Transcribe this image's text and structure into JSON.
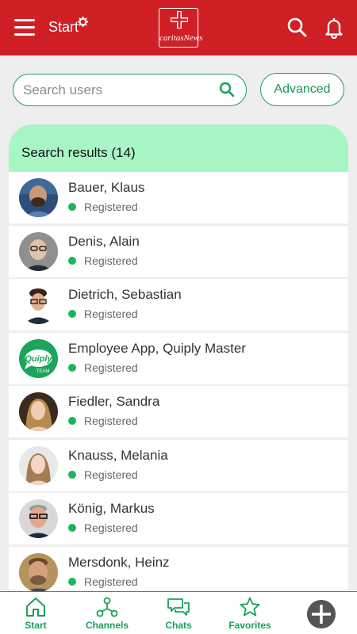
{
  "colors": {
    "brand_red": "#d11f26",
    "accent_green": "#1aa05a",
    "header_green": "#a8f5c6",
    "status_green": "#1bb55c"
  },
  "topbar": {
    "title": "Start",
    "logo_text": "caritasNews",
    "icons": [
      "menu-icon",
      "gear-icon",
      "caritas-logo",
      "search-icon",
      "bell-icon"
    ]
  },
  "search": {
    "placeholder": "Search users",
    "value": "",
    "advanced_label": "Advanced"
  },
  "results": {
    "header": "Search results (14)",
    "items": [
      {
        "name": "Bauer, Klaus",
        "status": "Registered"
      },
      {
        "name": "Denis, Alain",
        "status": "Registered"
      },
      {
        "name": "Dietrich, Sebastian",
        "status": "Registered"
      },
      {
        "name": "Employee App, Quiply Master",
        "status": "Registered"
      },
      {
        "name": "Fiedler, Sandra",
        "status": "Registered"
      },
      {
        "name": "Knauss, Melania",
        "status": "Registered"
      },
      {
        "name": "König, Markus",
        "status": "Registered"
      },
      {
        "name": "Mersdonk, Heinz",
        "status": "Registered"
      }
    ]
  },
  "bottom_nav": {
    "items": [
      {
        "label": "Start",
        "icon": "home-icon"
      },
      {
        "label": "Channels",
        "icon": "channels-icon"
      },
      {
        "label": "Chats",
        "icon": "chats-icon"
      },
      {
        "label": "Favorites",
        "icon": "star-icon"
      }
    ],
    "add_icon": "plus-icon"
  }
}
